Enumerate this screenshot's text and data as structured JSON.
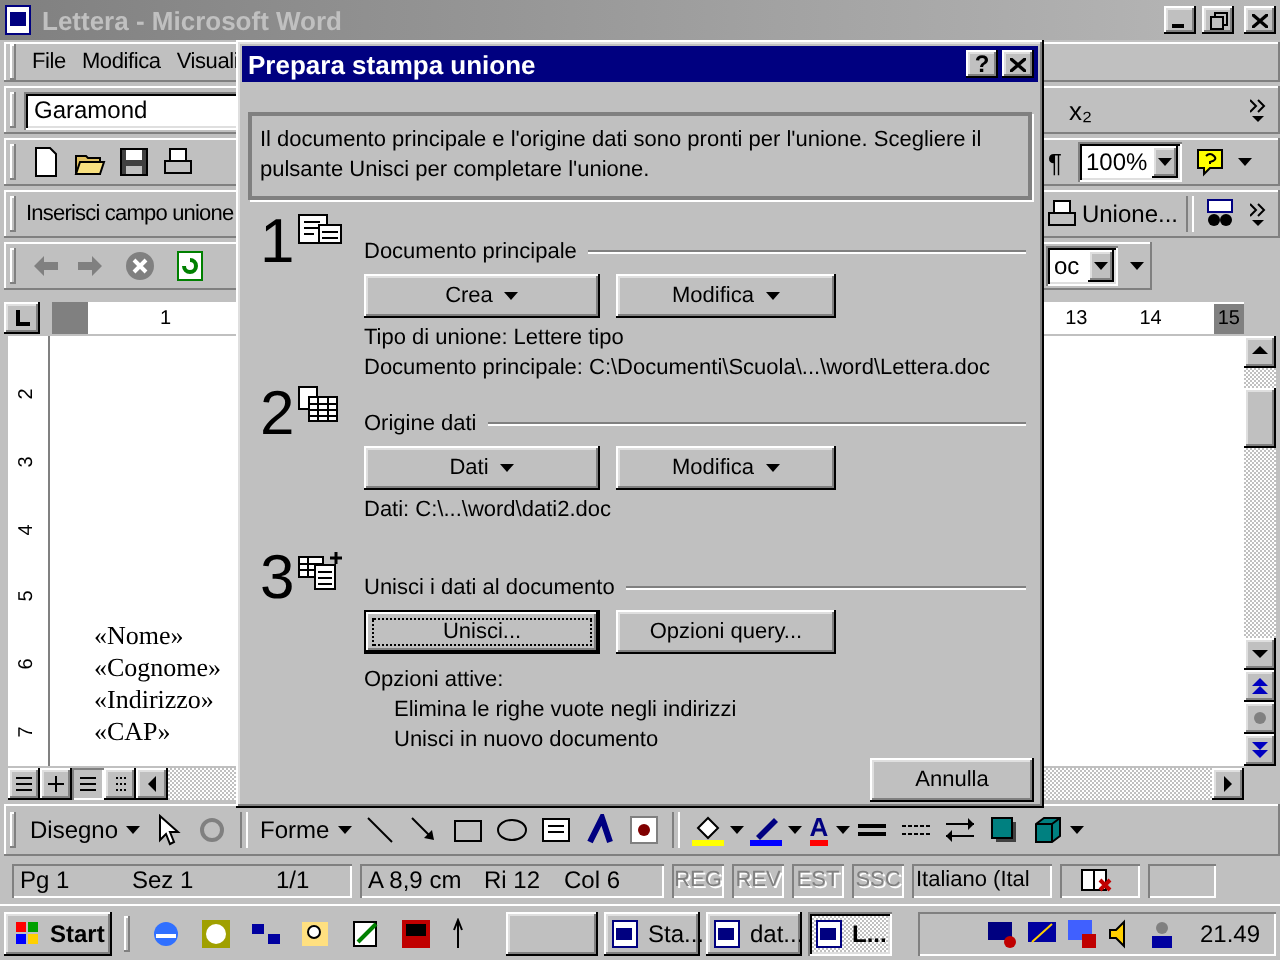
{
  "window": {
    "title": "Lettera - Microsoft Word"
  },
  "menu": [
    {
      "label": "File"
    },
    {
      "label": "Modifica"
    },
    {
      "label": "Visuali"
    }
  ],
  "formatting_toolbar": {
    "font": "Garamond",
    "subscript": "x₂"
  },
  "standard_toolbar": {
    "pilcrow": "¶",
    "zoom": "100%"
  },
  "mail_merge_toolbar": {
    "insert_field": "Inserisci campo unione",
    "merge": "Unione..."
  },
  "web_toolbar": {
    "address": "oc"
  },
  "ruler": {
    "left_numbers": [
      "1"
    ],
    "right_numbers": [
      "13",
      "14",
      "15"
    ]
  },
  "vertical_ruler": [
    "2",
    "3",
    "4",
    "5",
    "6",
    "7"
  ],
  "document": {
    "lines": [
      "«Nome»",
      "«Cognome»",
      "«Indirizzo»",
      "«CAP»"
    ]
  },
  "drawing_toolbar": {
    "draw_menu": "Disegno",
    "shapes_menu": "Forme",
    "font_color": "A"
  },
  "status_bar": {
    "panels": [
      {
        "items": [
          "Pg 1",
          "Sez 1",
          "1/1"
        ]
      },
      {
        "items": [
          "A 8,9 cm",
          "Ri 12",
          "Col 6"
        ]
      }
    ],
    "modes": [
      {
        "label": "REG",
        "active": false
      },
      {
        "label": "REV",
        "active": false
      },
      {
        "label": "EST",
        "active": false
      },
      {
        "label": "SSC",
        "active": false
      }
    ],
    "language": "Italiano (Ital"
  },
  "taskbar": {
    "start": "Start",
    "tasks": [
      {
        "label": "Sta...",
        "selected": false
      },
      {
        "label": "dat...",
        "selected": false
      },
      {
        "label": "L...",
        "selected": true
      }
    ],
    "clock": "21.49"
  },
  "dialog": {
    "title": "Prepara stampa unione",
    "help": "?",
    "intro": "Il documento principale e l'origine dati sono pronti per l'unione. Scegliere il pulsante Unisci per completare l'unione.",
    "steps": [
      {
        "number": "1",
        "heading": "Documento principale",
        "buttons": [
          {
            "label": "Crea",
            "menu": true,
            "default": false
          },
          {
            "label": "Modifica",
            "menu": true,
            "default": false
          }
        ],
        "notes": [
          {
            "text": "Tipo di unione: Lettere tipo",
            "indented": false
          },
          {
            "text": "Documento principale: C:\\Documenti\\Scuola\\...\\word\\Lettera.doc",
            "indented": false
          }
        ]
      },
      {
        "number": "2",
        "heading": "Origine dati",
        "buttons": [
          {
            "label": "Dati",
            "menu": true,
            "default": false
          },
          {
            "label": "Modifica",
            "menu": true,
            "default": false
          }
        ],
        "notes": [
          {
            "text": "Dati: C:\\...\\word\\dati2.doc",
            "indented": false
          }
        ]
      },
      {
        "number": "3",
        "heading": "Unisci i dati al documento",
        "buttons": [
          {
            "label": "Unisci...",
            "menu": false,
            "default": true
          },
          {
            "label": "Opzioni query...",
            "menu": false,
            "default": false
          }
        ],
        "notes": [
          {
            "text": "Opzioni attive:",
            "indented": false
          },
          {
            "text": "Elimina le righe vuote negli indirizzi",
            "indented": true
          },
          {
            "text": "Unisci in nuovo documento",
            "indented": true
          }
        ]
      }
    ],
    "cancel": "Annulla"
  }
}
